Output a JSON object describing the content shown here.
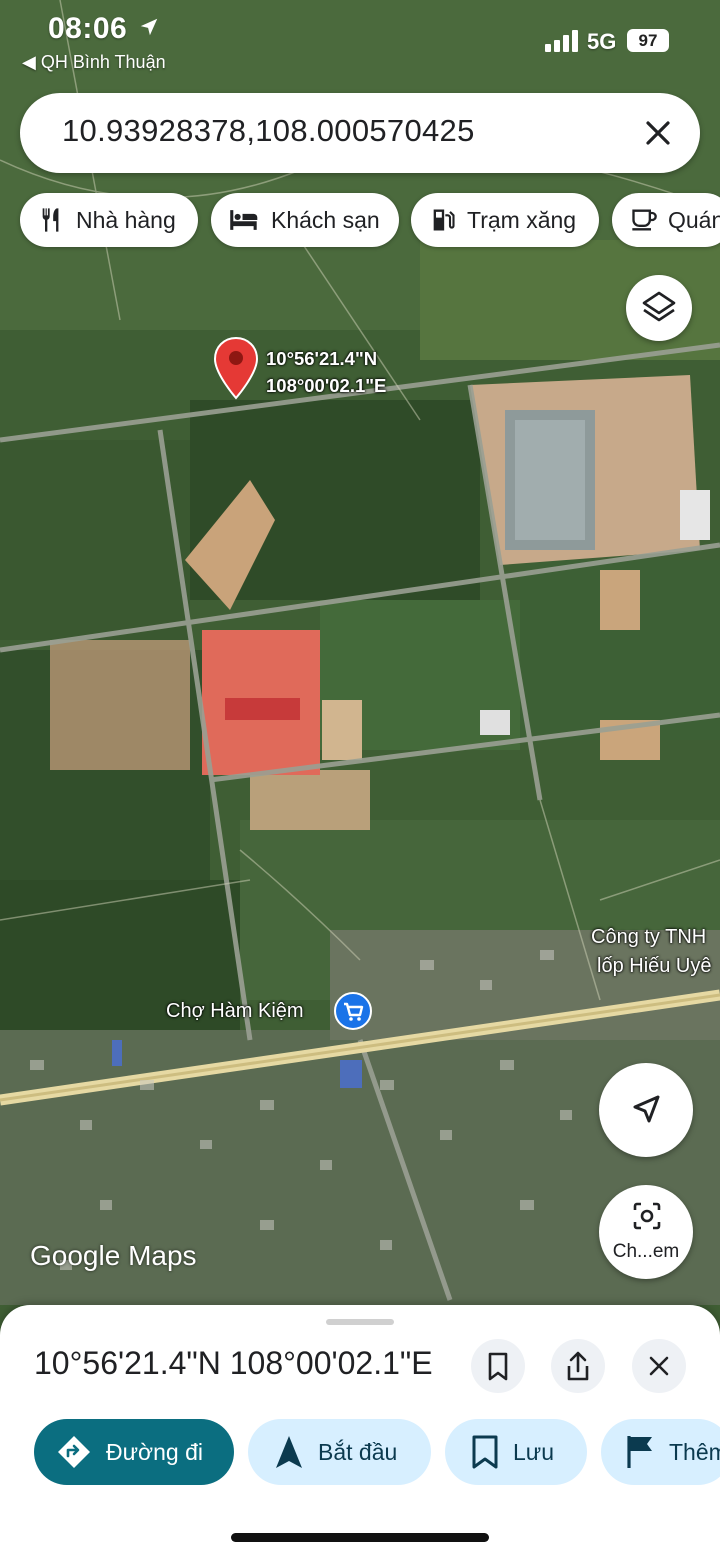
{
  "status_bar": {
    "time": "08:06",
    "back_app": "◀ QH Bình Thuận",
    "network": "5G",
    "battery": "97"
  },
  "search": {
    "value": "10.93928378,108.000570425"
  },
  "chips": [
    {
      "label": "Nhà hàng",
      "icon": "fork-knife-icon"
    },
    {
      "label": "Khách sạn",
      "icon": "bed-icon"
    },
    {
      "label": "Trạm xăng",
      "icon": "gas-station-icon"
    },
    {
      "label": "Quán",
      "icon": "coffee-cup-icon"
    }
  ],
  "pin": {
    "lat": "10°56'21.4\"N",
    "lng": "108°00'02.1\"E"
  },
  "places": {
    "company_line1": "Công ty TNH",
    "company_line2": "lốp Hiếu Uyê",
    "market": "Chợ Hàm Kiệm"
  },
  "branding": {
    "google_maps": "Google Maps"
  },
  "lens": {
    "label": "Ch...em"
  },
  "sheet": {
    "title": "10°56'21.4\"N 108°00'02.1\"E",
    "actions": {
      "directions": "Đường đi",
      "start": "Bắt đầu",
      "save": "Lưu",
      "more": "Thêm"
    }
  },
  "colors": {
    "pin_red": "#e53935",
    "primary_teal": "#0b6e80",
    "action_light": "#d7efff"
  }
}
